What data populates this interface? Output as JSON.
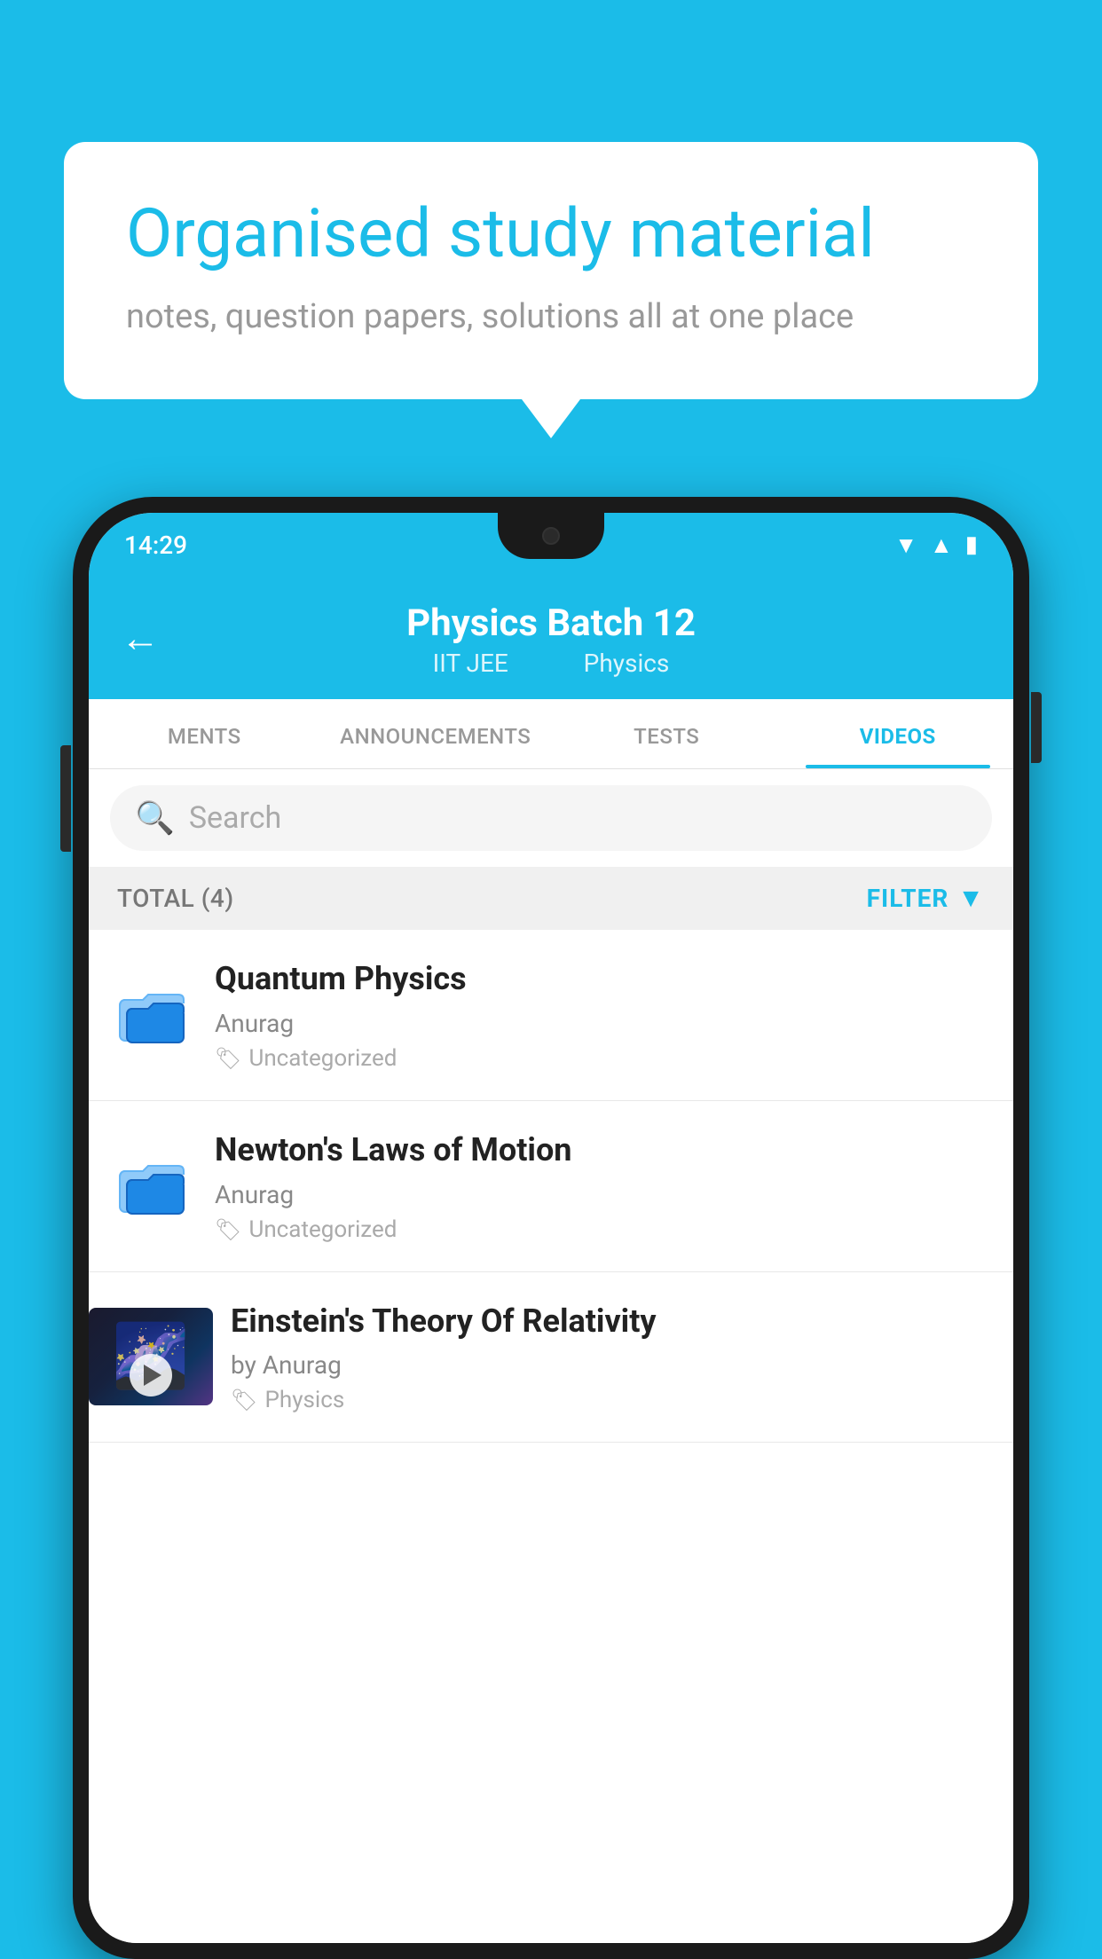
{
  "background_color": "#1BBCE8",
  "speech_bubble": {
    "title": "Organised study material",
    "subtitle": "notes, question papers, solutions all at one place"
  },
  "phone": {
    "status_bar": {
      "time": "14:29",
      "wifi": "▼",
      "signal": "▲",
      "battery": "▮"
    },
    "header": {
      "back_label": "←",
      "title": "Physics Batch 12",
      "subtitle_left": "IIT JEE",
      "subtitle_right": "Physics"
    },
    "tabs": [
      {
        "label": "MENTS",
        "active": false
      },
      {
        "label": "ANNOUNCEMENTS",
        "active": false
      },
      {
        "label": "TESTS",
        "active": false
      },
      {
        "label": "VIDEOS",
        "active": true
      }
    ],
    "search": {
      "placeholder": "Search"
    },
    "filter_bar": {
      "total_label": "TOTAL (4)",
      "filter_label": "FILTER"
    },
    "videos": [
      {
        "id": 1,
        "title": "Quantum Physics",
        "author": "Anurag",
        "tag": "Uncategorized",
        "has_thumbnail": false
      },
      {
        "id": 2,
        "title": "Newton's Laws of Motion",
        "author": "Anurag",
        "tag": "Uncategorized",
        "has_thumbnail": false
      },
      {
        "id": 3,
        "title": "Einstein's Theory Of Relativity",
        "author": "by Anurag",
        "tag": "Physics",
        "has_thumbnail": true
      }
    ]
  }
}
